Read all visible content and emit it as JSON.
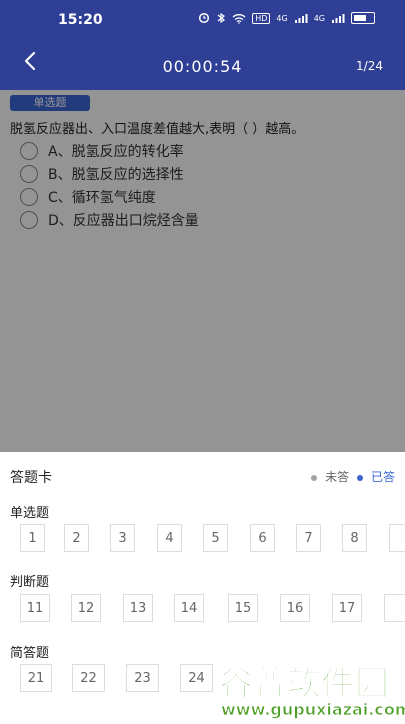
{
  "status": {
    "time": "15:20",
    "alarm": "alarm-icon",
    "bluetooth": "bluetooth-icon",
    "wifi": "wifi-icon",
    "hd": "HD",
    "signal1": "4G",
    "signal2": "4G"
  },
  "header": {
    "back_icon": "chevron-left-icon",
    "timer": "00:00:54",
    "progress": "1/24"
  },
  "question": {
    "type": "单选题",
    "text": "脱氢反应器出、入口温度差值越大,表明（ ）越高。",
    "options": [
      {
        "label": "A、脱氢反应的转化率"
      },
      {
        "label": "B、脱氢反应的选择性"
      },
      {
        "label": "C、循环氢气纯度"
      },
      {
        "label": "D、反应器出口烷烃含量"
      }
    ]
  },
  "answer_sheet": {
    "title": "答题卡",
    "legend_unanswered": "未答",
    "legend_answered": "已答",
    "sections": [
      {
        "label": "单选题",
        "items": [
          "1",
          "2",
          "3",
          "4",
          "5",
          "6",
          "7",
          "8"
        ]
      },
      {
        "label": "判断题",
        "items": [
          "11",
          "12",
          "13",
          "14",
          "15",
          "16",
          "17"
        ]
      },
      {
        "label": "简答题",
        "items": [
          "21",
          "22",
          "23",
          "24"
        ]
      }
    ]
  },
  "watermark": {
    "line1": "谷普软件园",
    "line2": "www.gupuxiazai.com"
  },
  "colors": {
    "header": "#2f3f95",
    "accent": "#3b67d8"
  }
}
